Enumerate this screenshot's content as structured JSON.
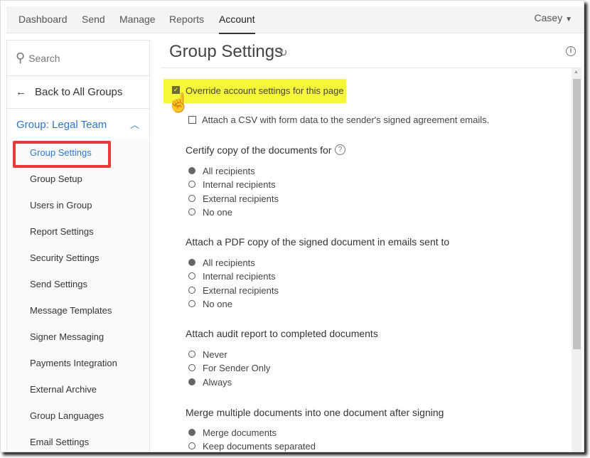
{
  "nav": {
    "tabs": [
      "Dashboard",
      "Send",
      "Manage",
      "Reports",
      "Account"
    ],
    "active": "Account",
    "user": "Casey"
  },
  "sidebar": {
    "search_placeholder": "Search",
    "back": "Back to All Groups",
    "group": "Group: Legal Team",
    "items": [
      "Group Settings",
      "Group Setup",
      "Users in Group",
      "Report Settings",
      "Security Settings",
      "Send Settings",
      "Message Templates",
      "Signer Messaging",
      "Payments Integration",
      "External Archive",
      "Group Languages",
      "Email Settings"
    ]
  },
  "page": {
    "title": "Group Settings",
    "override_label": "Override account settings for this page",
    "override_checked": true,
    "csv_label": "Attach a CSV with form data to the sender's signed agreement emails.",
    "csv_checked": false,
    "sections": [
      {
        "heading": "Certify copy of the documents for",
        "help": true,
        "options": [
          "All recipients",
          "Internal recipients",
          "External recipients",
          "No one"
        ],
        "selected": 0
      },
      {
        "heading": "Attach a PDF copy of the signed document in emails sent to",
        "options": [
          "All recipients",
          "Internal recipients",
          "External recipients",
          "No one"
        ],
        "selected": 0
      },
      {
        "heading": "Attach audit report to completed documents",
        "options": [
          "Never",
          "For Sender Only",
          "Always"
        ],
        "selected": 2
      },
      {
        "heading": "Merge multiple documents into one document after signing",
        "options": [
          "Merge documents",
          "Keep documents separated"
        ],
        "selected": 0
      }
    ]
  },
  "colors": {
    "accent": "#2d76c7",
    "highlight": "#f7f73a",
    "redbox": "#e53b3b"
  }
}
